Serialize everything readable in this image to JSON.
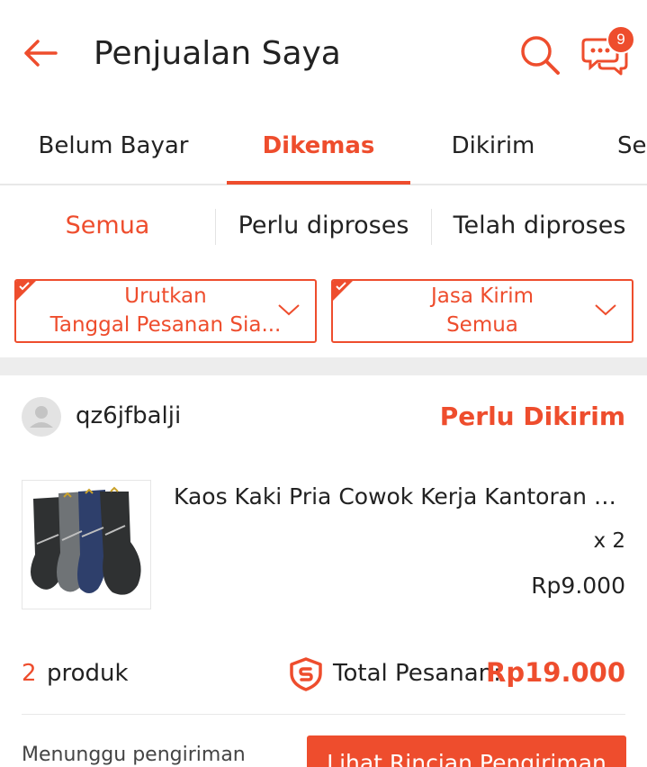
{
  "header": {
    "title": "Penjualan Saya",
    "chat_badge_count": "9",
    "icons": {
      "back": "back-arrow-icon",
      "search": "search-icon",
      "chat": "chat-icon"
    }
  },
  "tabs": [
    {
      "label": "Belum Bayar",
      "active": false
    },
    {
      "label": "Dikemas",
      "active": true
    },
    {
      "label": "Dikirim",
      "active": false
    },
    {
      "label": "Se",
      "active": false
    }
  ],
  "subtabs": [
    {
      "label": "Semua",
      "active": true
    },
    {
      "label": "Perlu diproses",
      "active": false
    },
    {
      "label": "Telah diproses",
      "active": false
    }
  ],
  "filters": [
    {
      "title": "Urutkan",
      "value": "Tanggal Pesanan Sia..."
    },
    {
      "title": "Jasa Kirim",
      "value": "Semua"
    }
  ],
  "order": {
    "shop_name": "qz6jfbalji",
    "status": "Perlu Dikirim",
    "product": {
      "name": "Kaos Kaki Pria Cowok Kerja Kantoran S...",
      "quantity": "x 2",
      "price": "Rp9.000"
    },
    "product_count": "2",
    "product_count_label": "produk",
    "total_label": "Total Pesanan:",
    "total_value": "Rp19.000",
    "shipping_wait": "Menunggu pengiriman",
    "action_label": "Lihat Rincian Pengiriman"
  },
  "colors": {
    "accent": "#ee4d2d",
    "text": "#222222",
    "divider": "#e8e8e8",
    "section_gap": "#ededed"
  }
}
